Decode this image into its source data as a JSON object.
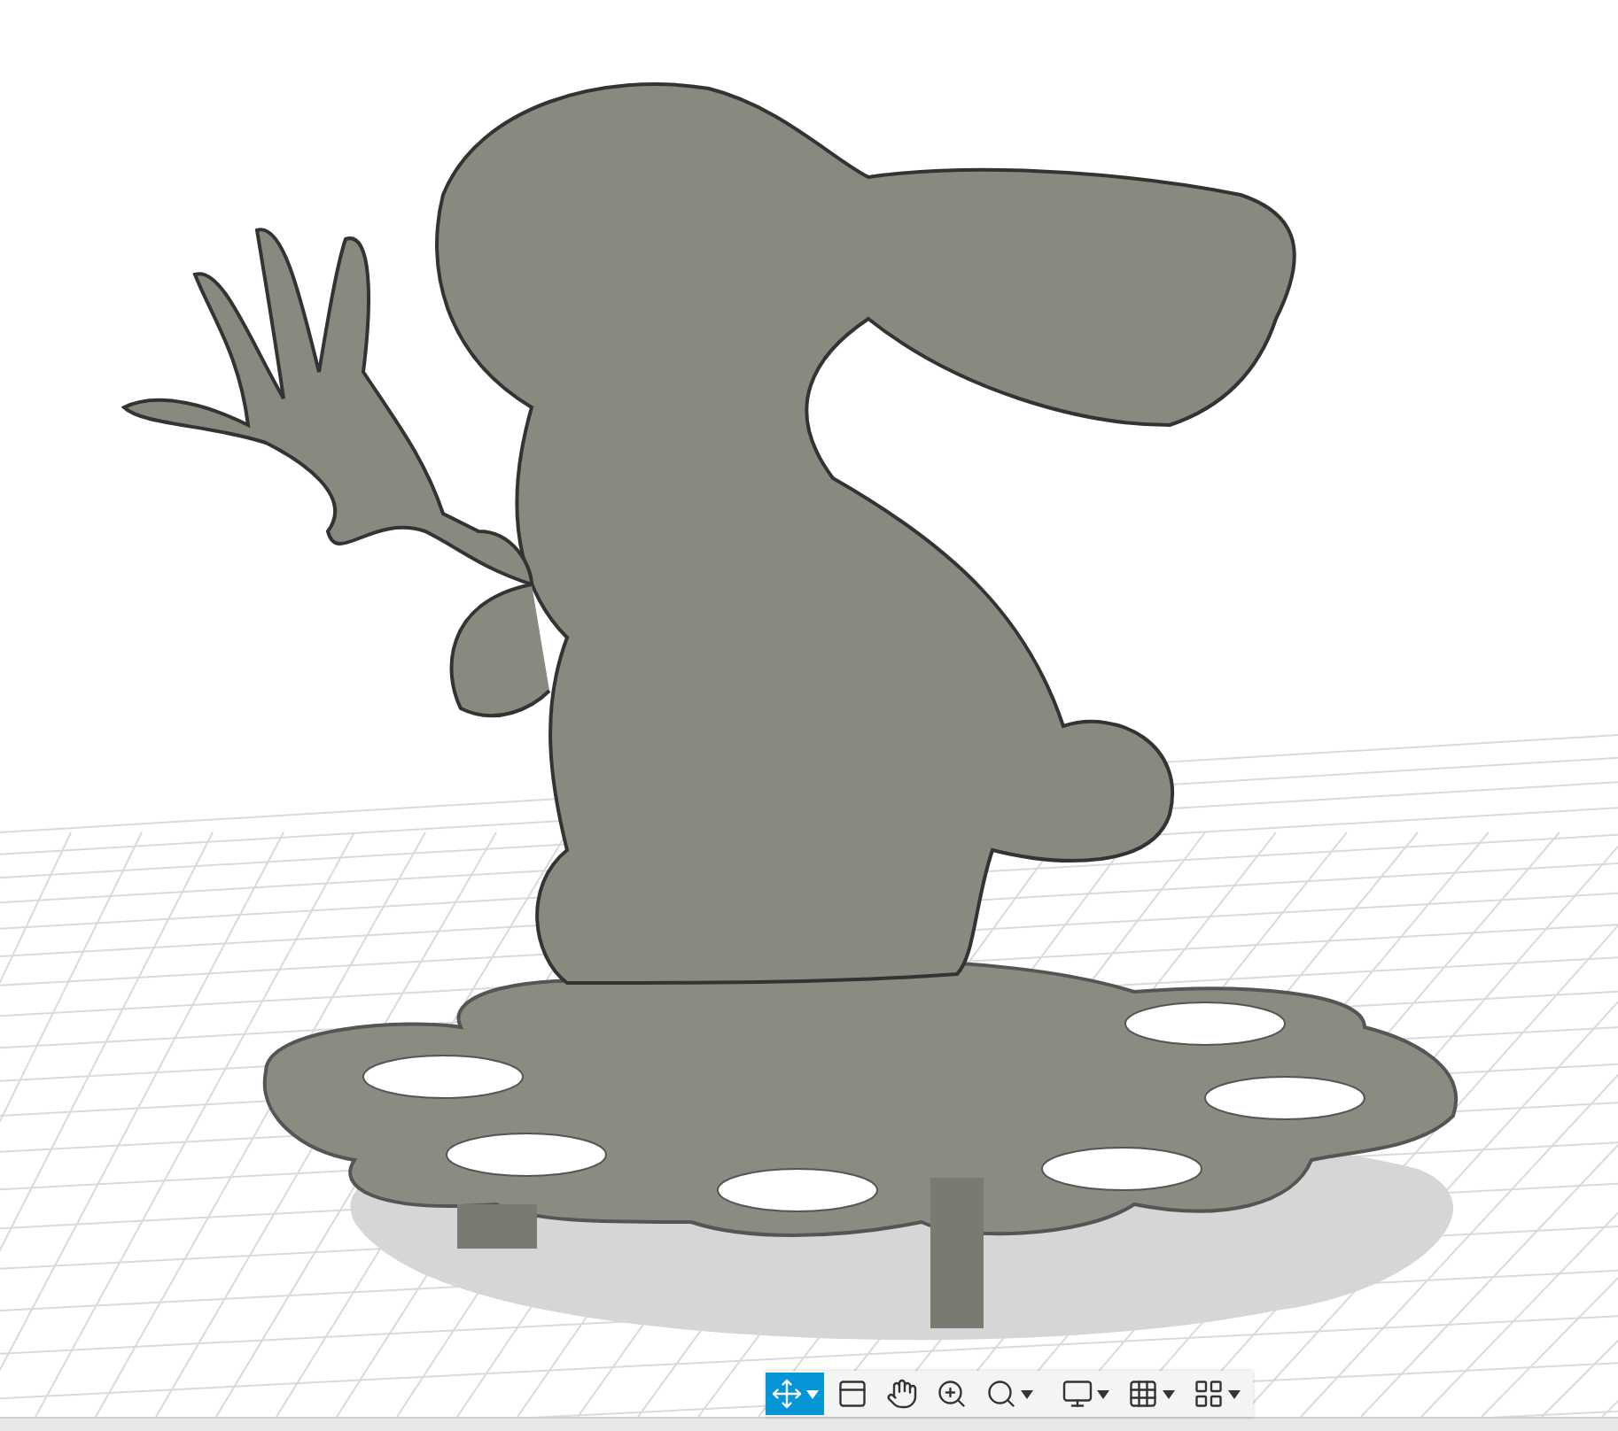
{
  "navigation_toolbar": {
    "tools": [
      {
        "kind": "orbit",
        "selected": true,
        "dropdown": true
      },
      {
        "kind": "look_at",
        "selected": false,
        "dropdown": false
      },
      {
        "kind": "pan",
        "selected": false,
        "dropdown": false
      },
      {
        "kind": "zoom",
        "selected": false,
        "dropdown": false
      },
      {
        "kind": "fit",
        "selected": false,
        "dropdown": true
      },
      {
        "kind": "display",
        "selected": false,
        "dropdown": true
      },
      {
        "kind": "grid",
        "selected": false,
        "dropdown": true
      },
      {
        "kind": "viewports",
        "selected": false,
        "dropdown": true
      }
    ]
  }
}
